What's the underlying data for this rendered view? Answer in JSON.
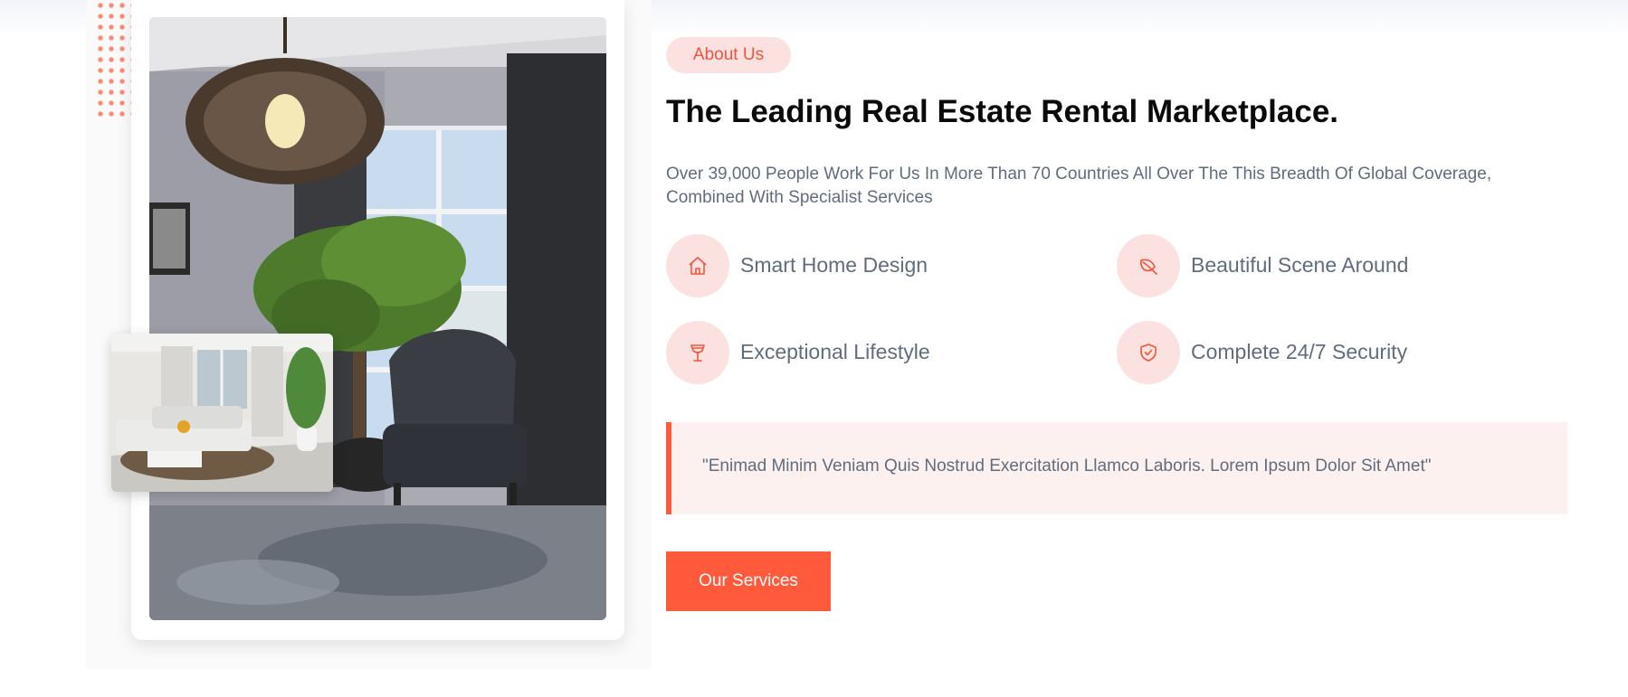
{
  "about": {
    "badge_label": "About Us",
    "heading": "The Leading Real Estate Rental Marketplace.",
    "description": "Over 39,000 People Work For Us In More Than 70 Countries All Over The This Breadth Of Global Coverage, Combined With Specialist Services",
    "features": [
      {
        "label": "Smart Home Design",
        "icon": "home-icon"
      },
      {
        "label": "Beautiful Scene Around",
        "icon": "leaf-icon"
      },
      {
        "label": "Exceptional Lifestyle",
        "icon": "cocktail-glass-icon"
      },
      {
        "label": "Complete 24/7 Security",
        "icon": "shield-check-icon"
      }
    ],
    "quote": "\"Enimad Minim Veniam Quis Nostrud Exercitation Llamco Laboris. Lorem Ipsum Dolor Sit Amet\"",
    "cta_label": "Our Services"
  },
  "colors": {
    "accent": "#ff5a3c",
    "accent_light": "#fbe1df",
    "quote_background": "#fdf1f0",
    "body_text": "#5f6d7e",
    "heading_text": "#0a0a0a"
  }
}
